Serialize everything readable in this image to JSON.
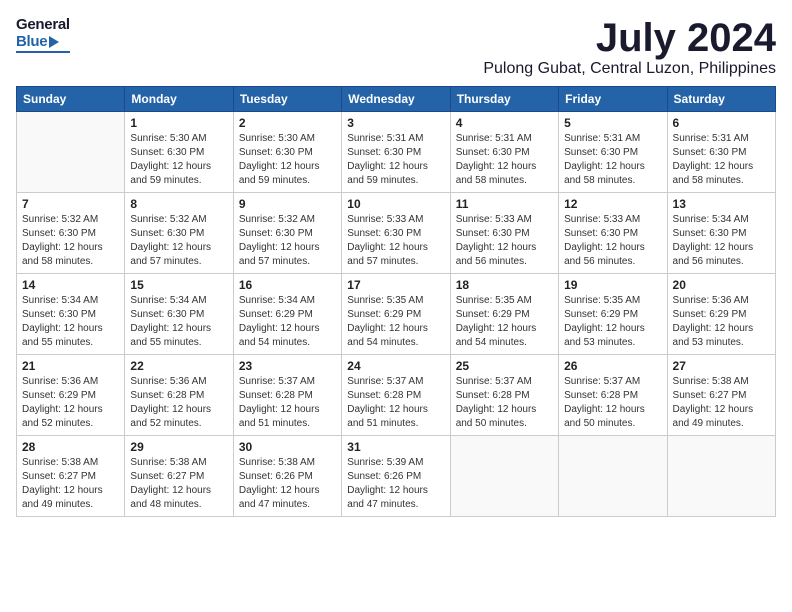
{
  "header": {
    "logo_general": "General",
    "logo_blue": "Blue",
    "month_title": "July 2024",
    "location": "Pulong Gubat, Central Luzon, Philippines"
  },
  "days_of_week": [
    "Sunday",
    "Monday",
    "Tuesday",
    "Wednesday",
    "Thursday",
    "Friday",
    "Saturday"
  ],
  "weeks": [
    [
      {
        "day": "",
        "info": ""
      },
      {
        "day": "1",
        "info": "Sunrise: 5:30 AM\nSunset: 6:30 PM\nDaylight: 12 hours\nand 59 minutes."
      },
      {
        "day": "2",
        "info": "Sunrise: 5:30 AM\nSunset: 6:30 PM\nDaylight: 12 hours\nand 59 minutes."
      },
      {
        "day": "3",
        "info": "Sunrise: 5:31 AM\nSunset: 6:30 PM\nDaylight: 12 hours\nand 59 minutes."
      },
      {
        "day": "4",
        "info": "Sunrise: 5:31 AM\nSunset: 6:30 PM\nDaylight: 12 hours\nand 58 minutes."
      },
      {
        "day": "5",
        "info": "Sunrise: 5:31 AM\nSunset: 6:30 PM\nDaylight: 12 hours\nand 58 minutes."
      },
      {
        "day": "6",
        "info": "Sunrise: 5:31 AM\nSunset: 6:30 PM\nDaylight: 12 hours\nand 58 minutes."
      }
    ],
    [
      {
        "day": "7",
        "info": "Sunrise: 5:32 AM\nSunset: 6:30 PM\nDaylight: 12 hours\nand 58 minutes."
      },
      {
        "day": "8",
        "info": "Sunrise: 5:32 AM\nSunset: 6:30 PM\nDaylight: 12 hours\nand 57 minutes."
      },
      {
        "day": "9",
        "info": "Sunrise: 5:32 AM\nSunset: 6:30 PM\nDaylight: 12 hours\nand 57 minutes."
      },
      {
        "day": "10",
        "info": "Sunrise: 5:33 AM\nSunset: 6:30 PM\nDaylight: 12 hours\nand 57 minutes."
      },
      {
        "day": "11",
        "info": "Sunrise: 5:33 AM\nSunset: 6:30 PM\nDaylight: 12 hours\nand 56 minutes."
      },
      {
        "day": "12",
        "info": "Sunrise: 5:33 AM\nSunset: 6:30 PM\nDaylight: 12 hours\nand 56 minutes."
      },
      {
        "day": "13",
        "info": "Sunrise: 5:34 AM\nSunset: 6:30 PM\nDaylight: 12 hours\nand 56 minutes."
      }
    ],
    [
      {
        "day": "14",
        "info": "Sunrise: 5:34 AM\nSunset: 6:30 PM\nDaylight: 12 hours\nand 55 minutes."
      },
      {
        "day": "15",
        "info": "Sunrise: 5:34 AM\nSunset: 6:30 PM\nDaylight: 12 hours\nand 55 minutes."
      },
      {
        "day": "16",
        "info": "Sunrise: 5:34 AM\nSunset: 6:29 PM\nDaylight: 12 hours\nand 54 minutes."
      },
      {
        "day": "17",
        "info": "Sunrise: 5:35 AM\nSunset: 6:29 PM\nDaylight: 12 hours\nand 54 minutes."
      },
      {
        "day": "18",
        "info": "Sunrise: 5:35 AM\nSunset: 6:29 PM\nDaylight: 12 hours\nand 54 minutes."
      },
      {
        "day": "19",
        "info": "Sunrise: 5:35 AM\nSunset: 6:29 PM\nDaylight: 12 hours\nand 53 minutes."
      },
      {
        "day": "20",
        "info": "Sunrise: 5:36 AM\nSunset: 6:29 PM\nDaylight: 12 hours\nand 53 minutes."
      }
    ],
    [
      {
        "day": "21",
        "info": "Sunrise: 5:36 AM\nSunset: 6:29 PM\nDaylight: 12 hours\nand 52 minutes."
      },
      {
        "day": "22",
        "info": "Sunrise: 5:36 AM\nSunset: 6:28 PM\nDaylight: 12 hours\nand 52 minutes."
      },
      {
        "day": "23",
        "info": "Sunrise: 5:37 AM\nSunset: 6:28 PM\nDaylight: 12 hours\nand 51 minutes."
      },
      {
        "day": "24",
        "info": "Sunrise: 5:37 AM\nSunset: 6:28 PM\nDaylight: 12 hours\nand 51 minutes."
      },
      {
        "day": "25",
        "info": "Sunrise: 5:37 AM\nSunset: 6:28 PM\nDaylight: 12 hours\nand 50 minutes."
      },
      {
        "day": "26",
        "info": "Sunrise: 5:37 AM\nSunset: 6:28 PM\nDaylight: 12 hours\nand 50 minutes."
      },
      {
        "day": "27",
        "info": "Sunrise: 5:38 AM\nSunset: 6:27 PM\nDaylight: 12 hours\nand 49 minutes."
      }
    ],
    [
      {
        "day": "28",
        "info": "Sunrise: 5:38 AM\nSunset: 6:27 PM\nDaylight: 12 hours\nand 49 minutes."
      },
      {
        "day": "29",
        "info": "Sunrise: 5:38 AM\nSunset: 6:27 PM\nDaylight: 12 hours\nand 48 minutes."
      },
      {
        "day": "30",
        "info": "Sunrise: 5:38 AM\nSunset: 6:26 PM\nDaylight: 12 hours\nand 47 minutes."
      },
      {
        "day": "31",
        "info": "Sunrise: 5:39 AM\nSunset: 6:26 PM\nDaylight: 12 hours\nand 47 minutes."
      },
      {
        "day": "",
        "info": ""
      },
      {
        "day": "",
        "info": ""
      },
      {
        "day": "",
        "info": ""
      }
    ]
  ]
}
